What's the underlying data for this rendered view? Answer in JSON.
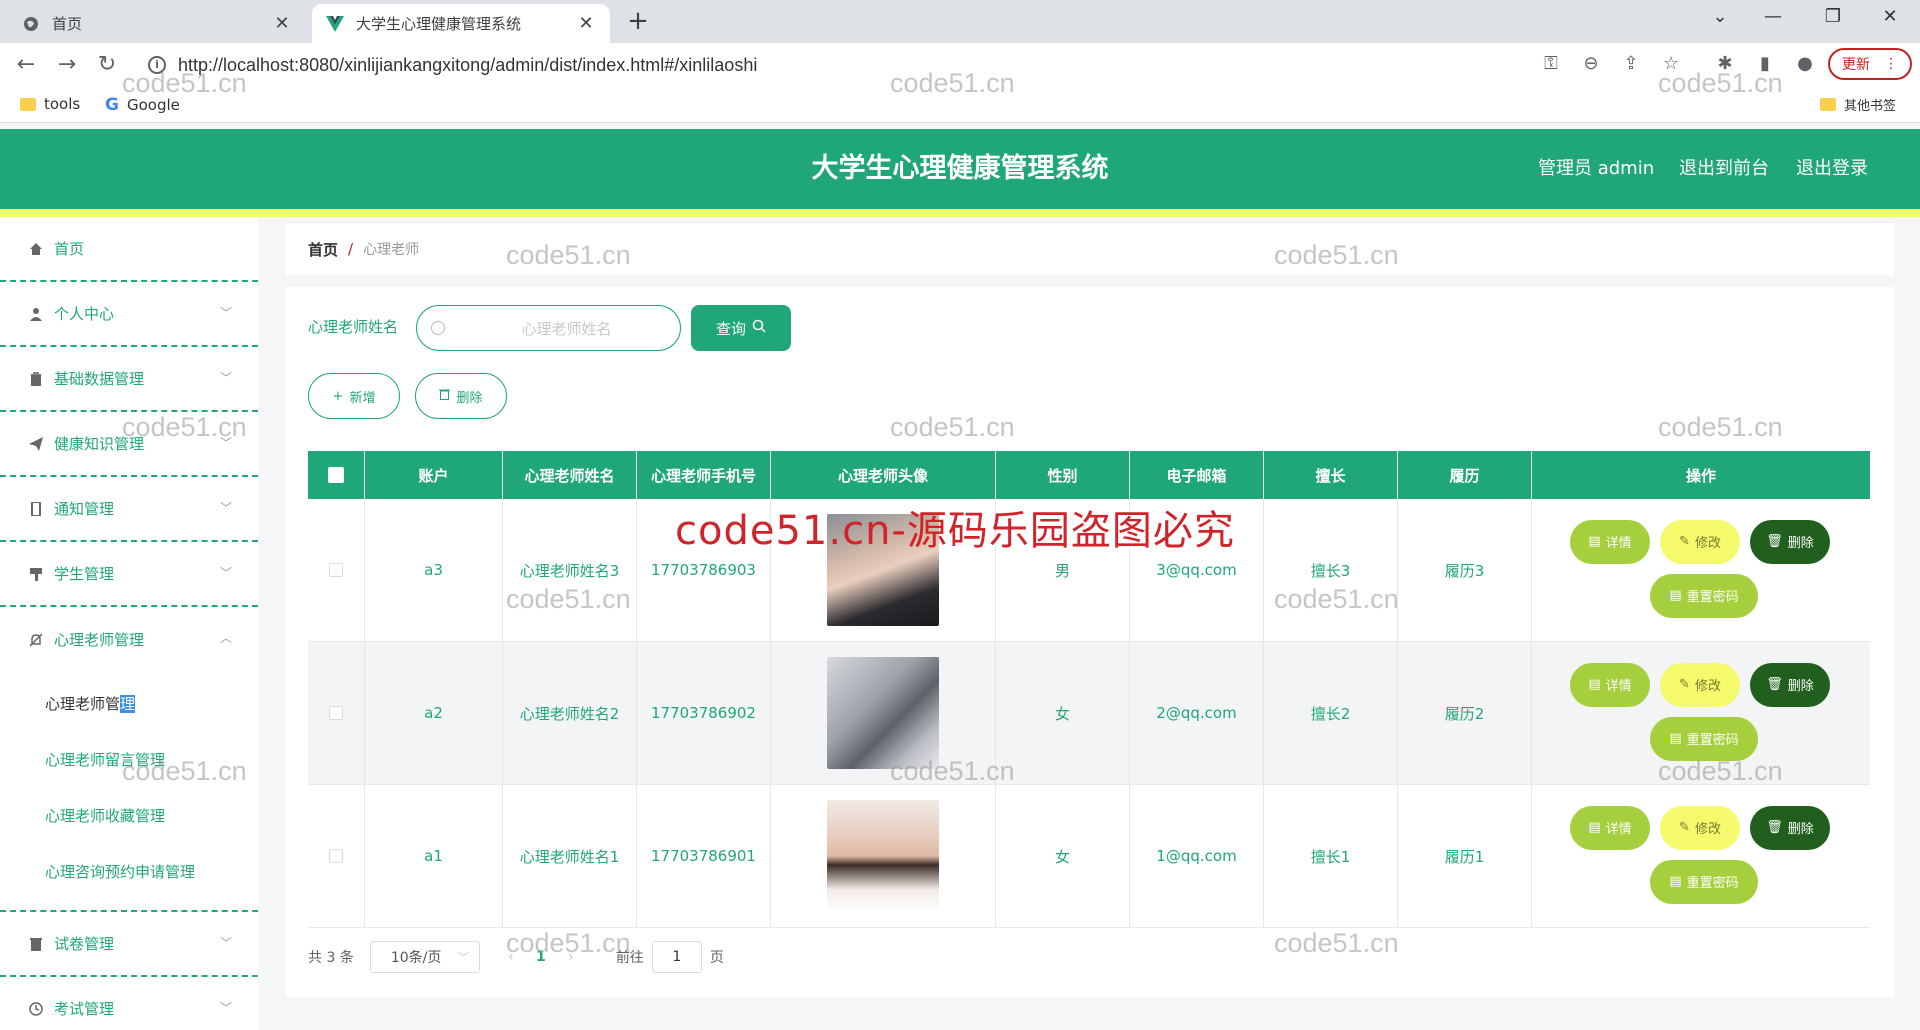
{
  "browser": {
    "tabs": [
      {
        "label": "首页"
      },
      {
        "label": "大学生心理健康管理系统"
      }
    ],
    "url": "http://localhost:8080/xinlijiankangxitong/admin/dist/index.html#/xinlilaoshi",
    "update_label": "更新",
    "bookmarks": [
      {
        "label": "tools"
      },
      {
        "label": "Google"
      }
    ],
    "other_bookmarks": "其他书签"
  },
  "header": {
    "title": "大学生心理健康管理系统",
    "user": "管理员 admin",
    "front_link": "退出到前台",
    "logout": "退出登录"
  },
  "sidebar": {
    "items": [
      {
        "label": "首页",
        "icon": "home-icon"
      },
      {
        "label": "个人中心",
        "icon": "user-icon"
      },
      {
        "label": "基础数据管理",
        "icon": "clipboard-icon"
      },
      {
        "label": "健康知识管理",
        "icon": "send-icon"
      },
      {
        "label": "通知管理",
        "icon": "phone-icon"
      },
      {
        "label": "学生管理",
        "icon": "brush-icon"
      },
      {
        "label": "心理老师管理",
        "icon": "bell-off-icon"
      }
    ],
    "submenu": [
      {
        "label_a": "心理老师管",
        "label_b": "理"
      },
      {
        "label": "心理老师留言管理"
      },
      {
        "label": "心理老师收藏管理"
      },
      {
        "label": "心理咨询预约申请管理"
      }
    ],
    "items_after": [
      {
        "label": "试卷管理",
        "icon": "delete-icon"
      },
      {
        "label": "考试管理",
        "icon": "clock-icon"
      }
    ]
  },
  "breadcrumb": {
    "home": "首页",
    "separator": "/",
    "current": "心理老师"
  },
  "search": {
    "label": "心理老师姓名",
    "placeholder": "心理老师姓名",
    "query_label": "查询"
  },
  "actions": {
    "add_label": "新增",
    "delete_label": "删除"
  },
  "table": {
    "headers": [
      "账户",
      "心理老师姓名",
      "心理老师手机号",
      "心理老师头像",
      "性别",
      "电子邮箱",
      "擅长",
      "履历",
      "操作"
    ],
    "rows": [
      {
        "account": "a3",
        "name": "心理老师姓名3",
        "phone": "17703786903",
        "gender": "男",
        "email": "3@qq.com",
        "specialty": "擅长3",
        "resume": "履历3"
      },
      {
        "account": "a2",
        "name": "心理老师姓名2",
        "phone": "17703786902",
        "gender": "女",
        "email": "2@qq.com",
        "specialty": "擅长2",
        "resume": "履历2"
      },
      {
        "account": "a1",
        "name": "心理老师姓名1",
        "phone": "17703786901",
        "gender": "女",
        "email": "1@qq.com",
        "specialty": "擅长1",
        "resume": "履历1"
      }
    ],
    "op_labels": {
      "detail": "详情",
      "edit": "修改",
      "delete": "删除",
      "reset": "重置密码"
    }
  },
  "pagination": {
    "total": "共 3 条",
    "page_size": "10条/页",
    "current": "1",
    "goto_prefix": "前往",
    "goto_value": "1",
    "goto_suffix": "页"
  },
  "watermarks": {
    "text": "code51.cn",
    "red": "code51.cn-源码乐园盗图必究"
  },
  "colors": {
    "brand": "#20a777",
    "accent_yellow": "#f1fb68",
    "danger": "#205f1d"
  }
}
